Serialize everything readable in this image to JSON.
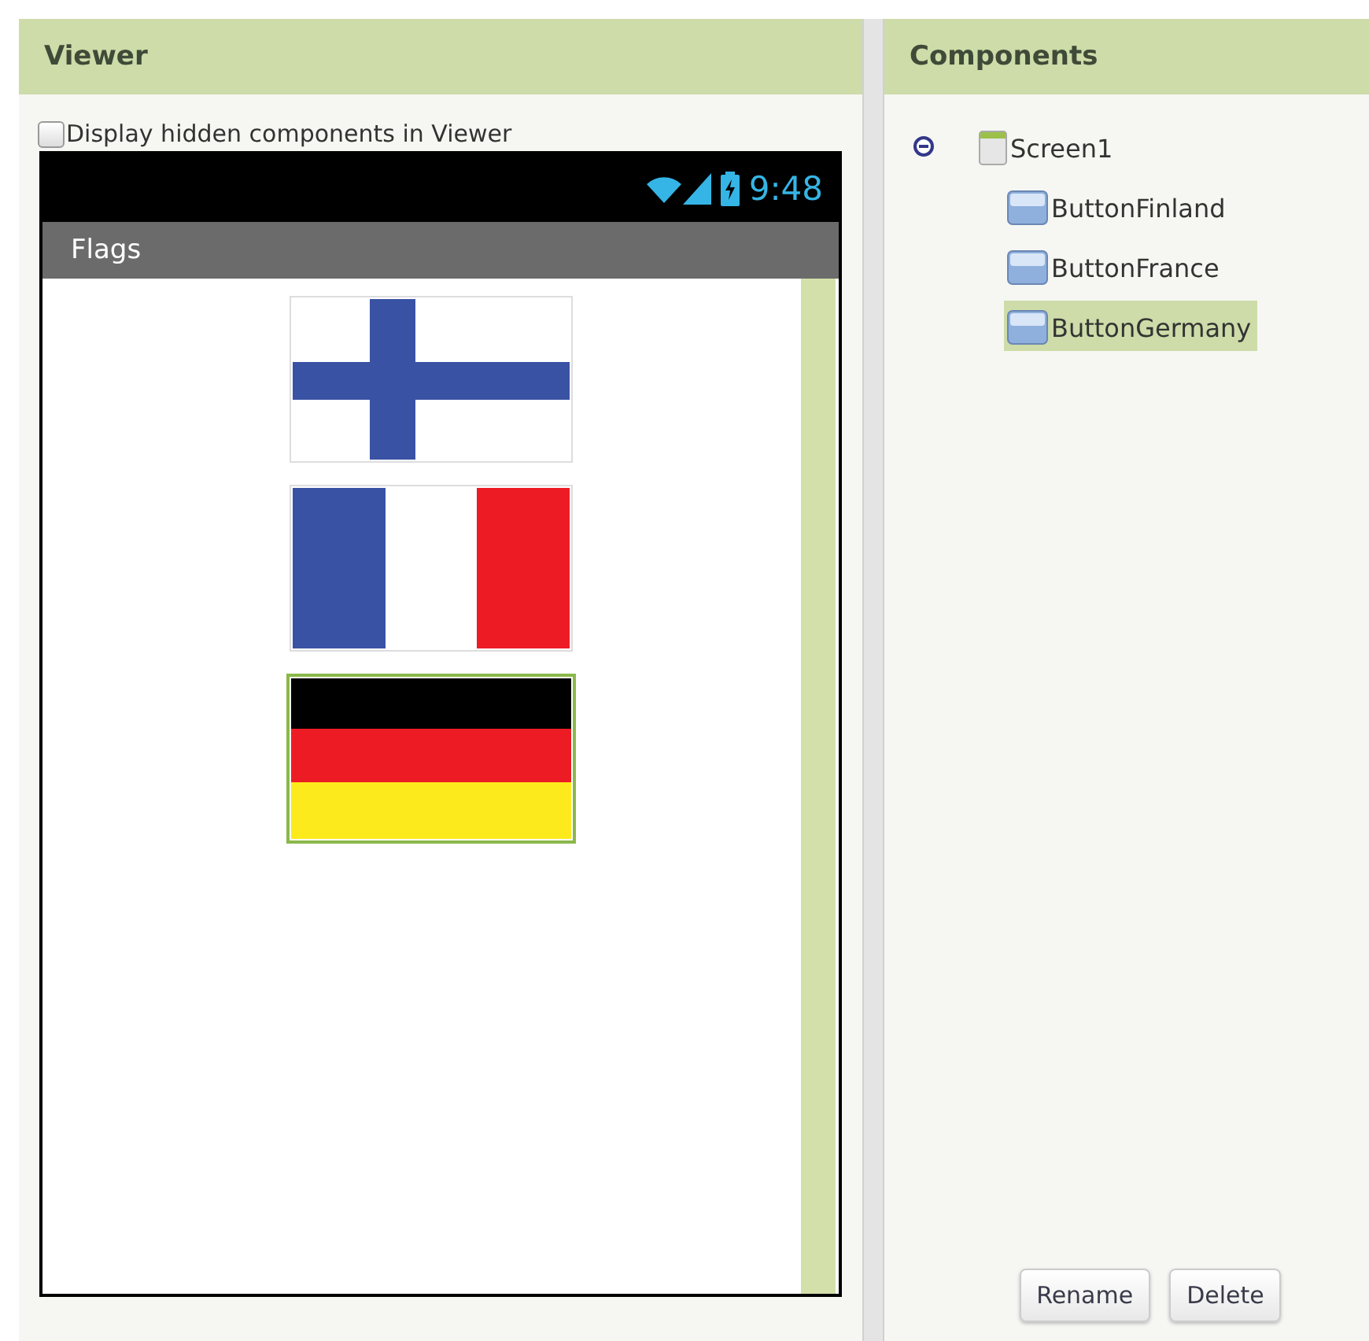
{
  "viewer": {
    "title": "Viewer",
    "hidden_checkbox": {
      "label": "Display hidden components in Viewer",
      "checked": false
    },
    "phone": {
      "time": "9:48",
      "title": "Flags",
      "buttons": [
        {
          "kind": "finland",
          "selected": false
        },
        {
          "kind": "france",
          "selected": false
        },
        {
          "kind": "germany",
          "selected": true
        }
      ]
    }
  },
  "components": {
    "title": "Components",
    "tree": [
      {
        "label": "Screen1",
        "kind": "screen",
        "expanded": true,
        "selected": false,
        "children": [
          {
            "label": "ButtonFinland",
            "kind": "button",
            "selected": false
          },
          {
            "label": "ButtonFrance",
            "kind": "button",
            "selected": false
          },
          {
            "label": "ButtonGermany",
            "kind": "button",
            "selected": true
          }
        ]
      }
    ]
  },
  "buttons": [
    "Rename",
    "Delete"
  ]
}
